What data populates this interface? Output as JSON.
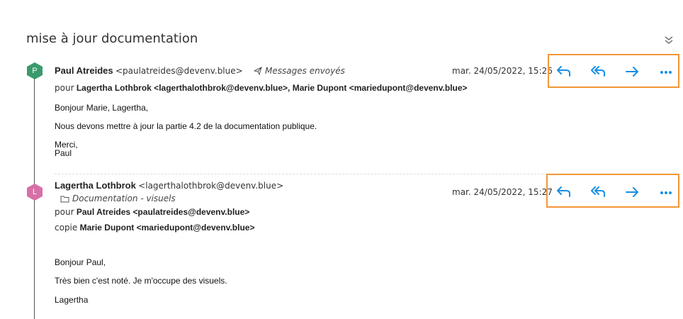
{
  "subject": "mise à jour documentation",
  "colors": {
    "accent": "#1a8fe3",
    "highlight": "#f39637",
    "avatar_p": "#3a9a6c",
    "avatar_l": "#d770a6"
  },
  "icons": {
    "collapse": "collapse-icon",
    "sent": "paper-plane-icon",
    "folder": "folder-icon",
    "reply": "reply-icon",
    "reply_all": "reply-all-icon",
    "forward": "forward-icon",
    "more": "more-icon"
  },
  "messages": [
    {
      "avatar_letter": "P",
      "sender": "Paul Atreides",
      "email": "<paulatreides@devenv.blue>",
      "folder": "Messages envoyés",
      "date": "mar. 24/05/2022, 15:26",
      "to_prefix": "pour",
      "to": "Lagertha Lothbrok <lagerthalothbrok@devenv.blue>, Marie Dupont <mariedupont@devenv.blue>",
      "body": [
        "Bonjour Marie, Lagertha,",
        "Nous devons mettre à jour la partie 4.2 de la documentation publique.",
        "Merci,",
        "Paul"
      ]
    },
    {
      "avatar_letter": "L",
      "sender": "Lagertha Lothbrok",
      "email": "<lagerthalothbrok@devenv.blue>",
      "folder": "Documentation - visuels",
      "date": "mar. 24/05/2022, 15:27",
      "to_prefix": "pour",
      "to": "Paul Atreides <paulatreides@devenv.blue>",
      "cc_prefix": "copie",
      "cc": "Marie Dupont <mariedupont@devenv.blue>",
      "body": [
        "Bonjour Paul,",
        "Très bien c'est noté. Je m'occupe des visuels.",
        "Lagertha"
      ]
    }
  ]
}
